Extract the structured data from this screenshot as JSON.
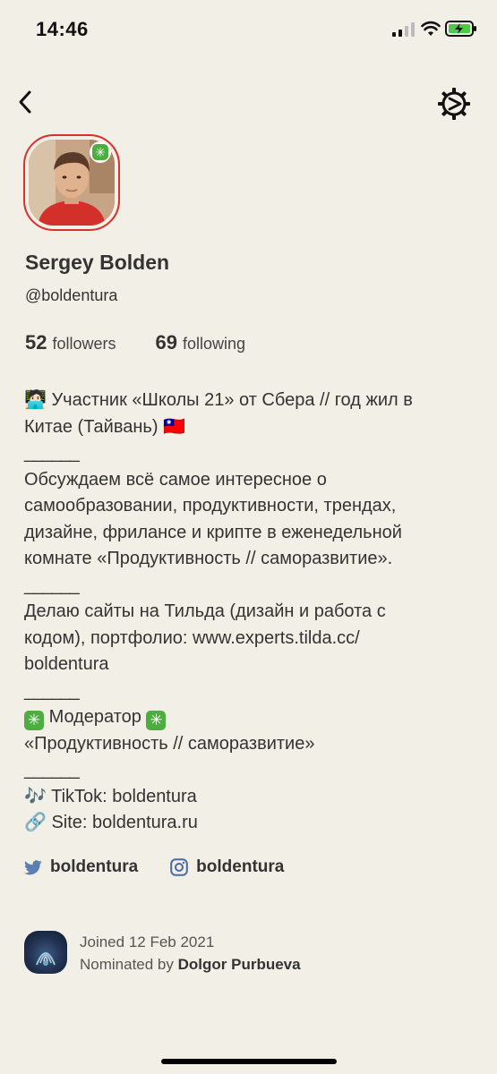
{
  "status_bar": {
    "time": "14:46"
  },
  "profile": {
    "name": "Sergey Bolden",
    "username": "@boldentura",
    "followers_count": "52",
    "followers_label": "followers",
    "following_count": "69",
    "following_label": "following"
  },
  "bio": {
    "line1": "🧑🏻‍💻 Участник «Школы 21» от Сбера // год жил в",
    "line2": "Китае (Тайвань) 🇹🇼",
    "sep1": "______",
    "line3": "Обсуждаем всё самое интересное о",
    "line4": "самообразовании, продуктивности, трендах,",
    "line5": "дизайне, фрилансе и крипте в еженедельной",
    "line6": "комнате «Продуктивность // саморазвитие».",
    "sep2": "______",
    "line7": "Делаю сайты на Тильда (дизайн и работа с",
    "line8": "кодом), портфолио: www.experts.tilda.cc/",
    "line9": "boldentura",
    "sep3": "______",
    "moderator_label": "Модератор",
    "line10": "«Продуктивность // саморазвитие»",
    "sep4": "______",
    "tiktok": "🎶 TikTok: boldentura",
    "site": "🔗 Site: boldentura.ru"
  },
  "social": {
    "twitter": "boldentura",
    "instagram": "boldentura"
  },
  "footer": {
    "joined": "Joined 12 Feb 2021",
    "nominated_prefix": "Nominated by",
    "nominator": "Dolgor Purbueva"
  },
  "colors": {
    "background": "#f2efe6",
    "avatar_ring": "#d9302e",
    "moderator_green": "#4cae3e",
    "twitter_blue": "#5b7fb3",
    "instagram_blue": "#4a6aa0"
  },
  "icons": {
    "back": "chevron-left-icon",
    "settings": "gear-icon",
    "twitter": "twitter-icon",
    "instagram": "instagram-icon"
  }
}
